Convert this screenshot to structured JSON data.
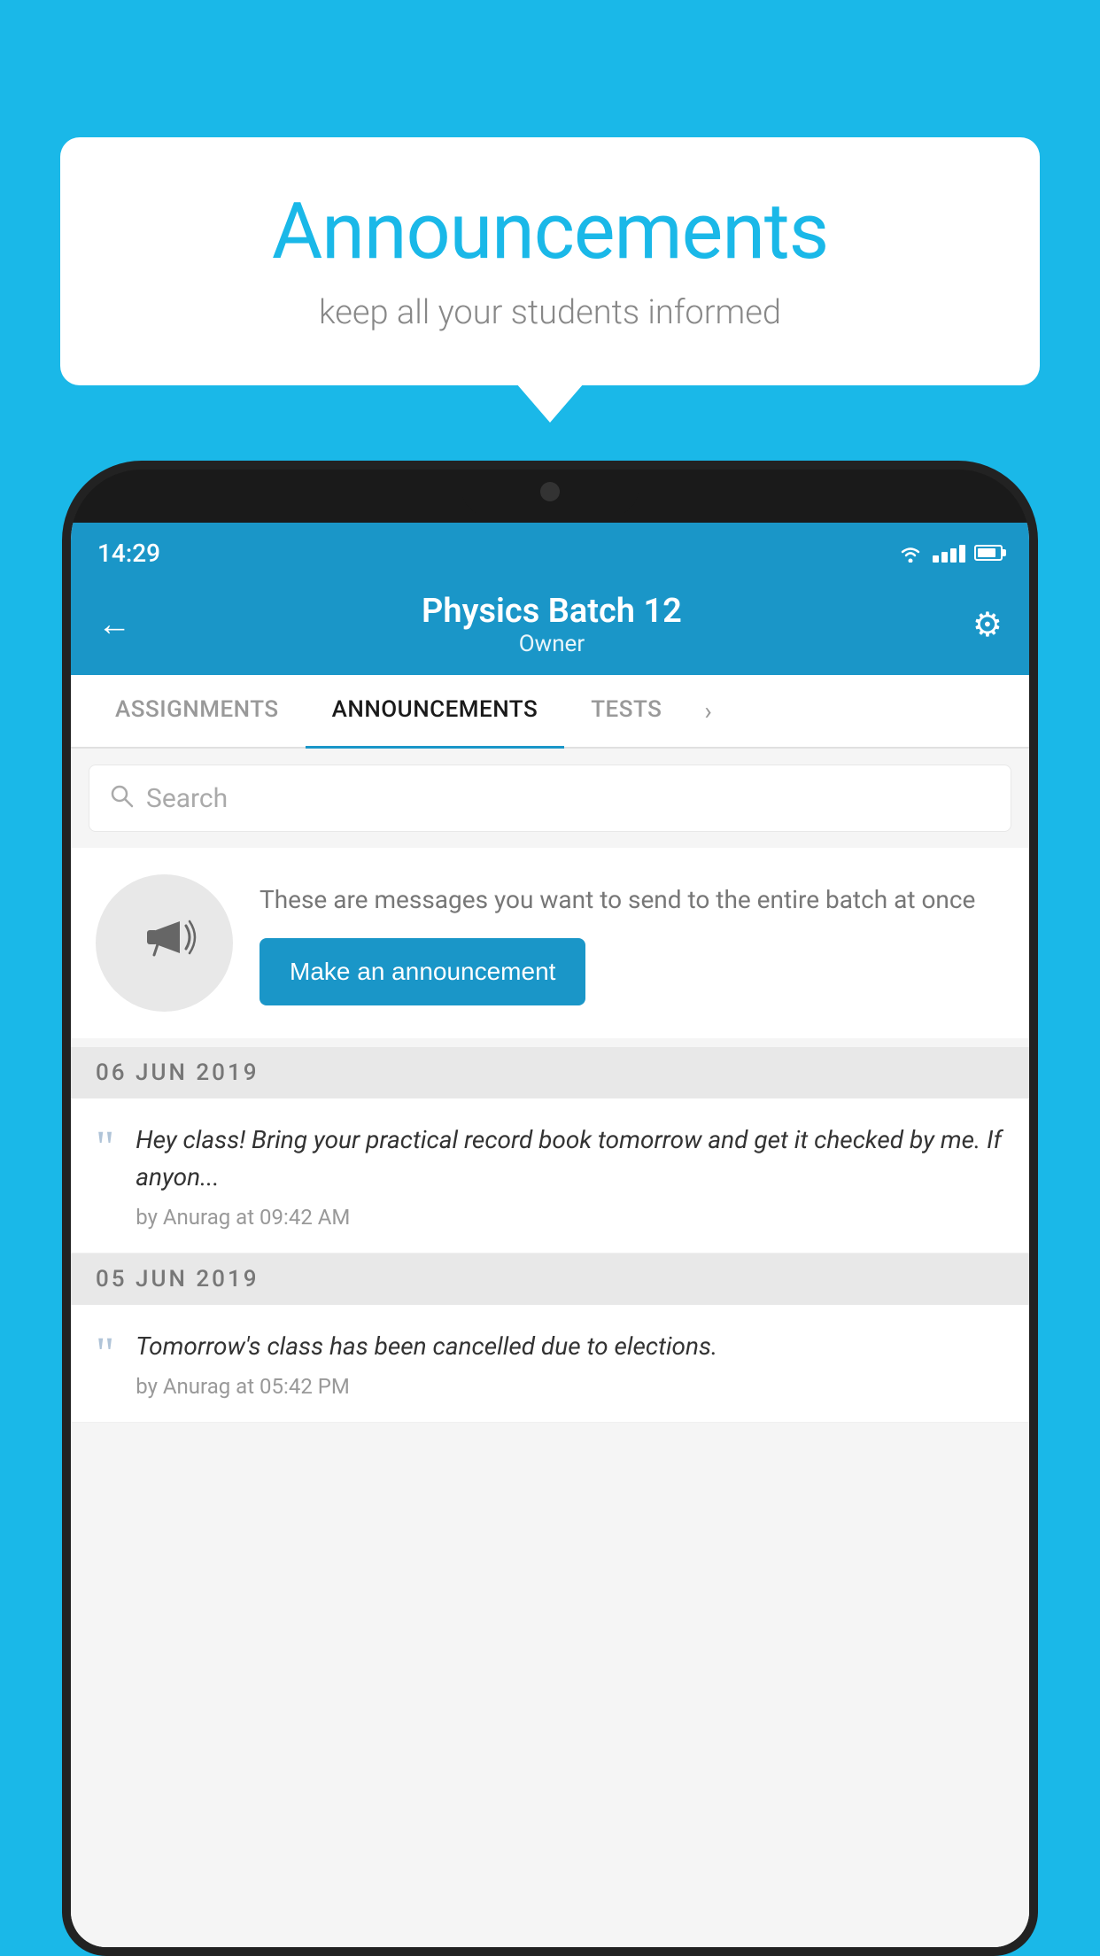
{
  "background_color": "#1ab8e8",
  "speech_bubble": {
    "title": "Announcements",
    "subtitle": "keep all your students informed"
  },
  "phone": {
    "status_bar": {
      "time": "14:29"
    },
    "header": {
      "back_label": "←",
      "title": "Physics Batch 12",
      "subtitle": "Owner",
      "gear_symbol": "⚙"
    },
    "tabs": [
      {
        "label": "ASSIGNMENTS",
        "active": false
      },
      {
        "label": "ANNOUNCEMENTS",
        "active": true
      },
      {
        "label": "TESTS",
        "active": false
      }
    ],
    "search": {
      "placeholder": "Search"
    },
    "promo_card": {
      "description": "These are messages you want to send to the entire batch at once",
      "button_label": "Make an announcement"
    },
    "announcements": [
      {
        "date": "06  JUN  2019",
        "text": "Hey class! Bring your practical record book tomorrow and get it checked by me. If anyon...",
        "meta": "by Anurag at 09:42 AM"
      },
      {
        "date": "05  JUN  2019",
        "text": "Tomorrow's class has been cancelled due to elections.",
        "meta": "by Anurag at 05:42 PM"
      }
    ]
  }
}
